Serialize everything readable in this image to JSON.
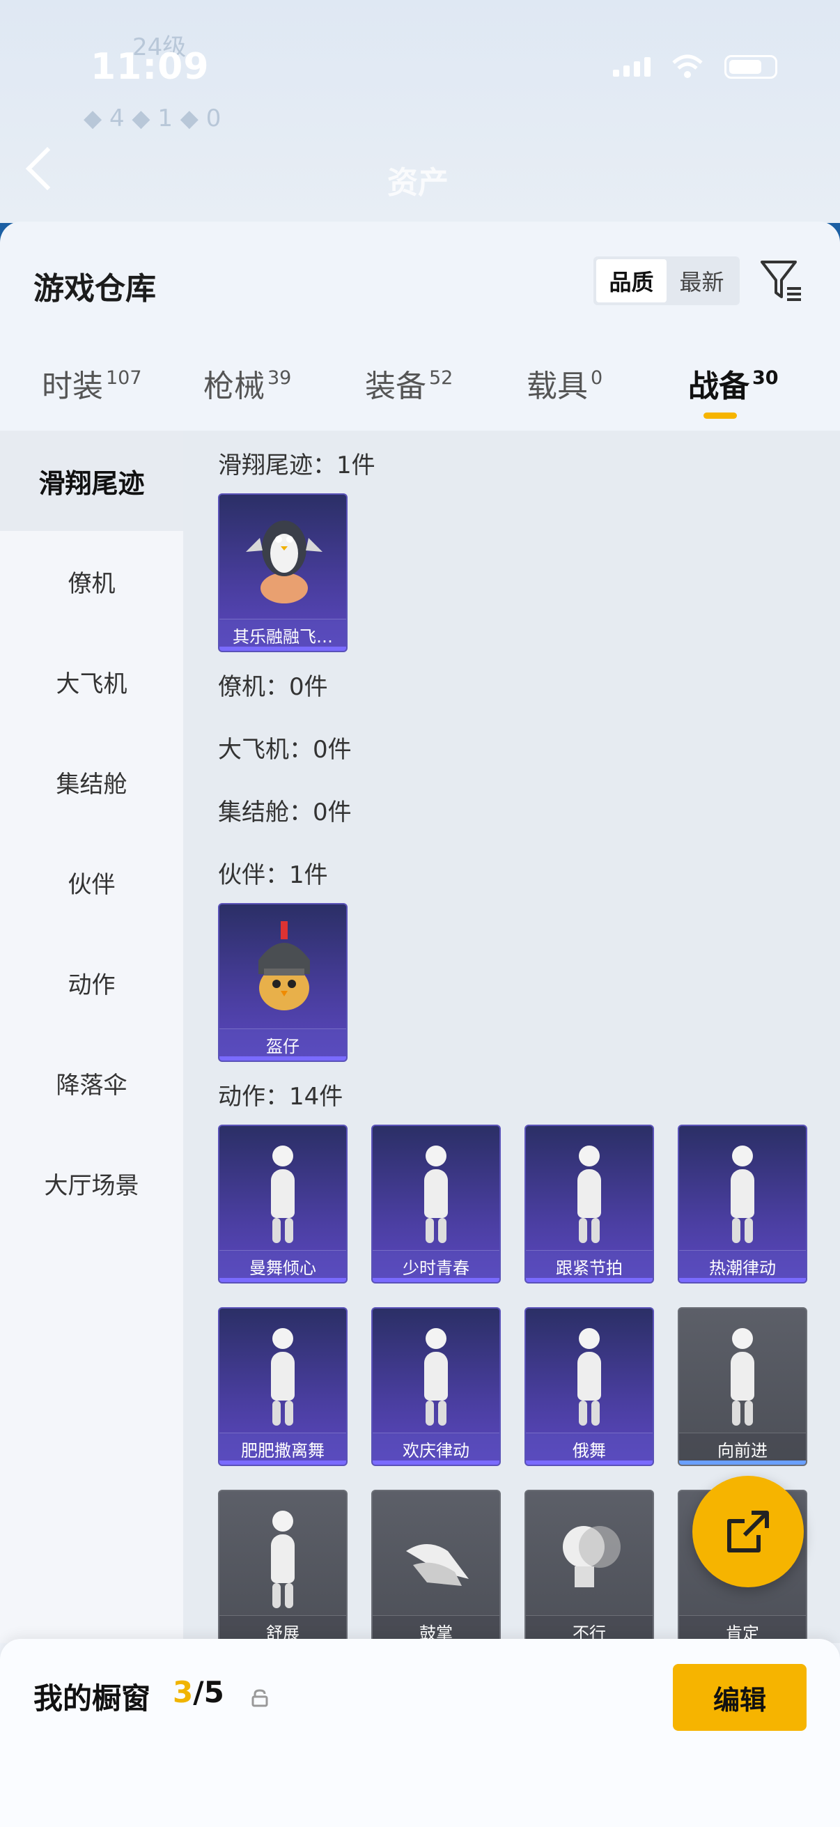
{
  "status": {
    "time": "11:09"
  },
  "header": {
    "title": "资产"
  },
  "sheet": {
    "title": "游戏仓库",
    "sort": {
      "options": [
        "品质",
        "最新"
      ],
      "selected": "品质"
    }
  },
  "tabs": [
    {
      "label": "时装",
      "count": "107"
    },
    {
      "label": "枪械",
      "count": "39"
    },
    {
      "label": "装备",
      "count": "52"
    },
    {
      "label": "载具",
      "count": "0"
    },
    {
      "label": "战备",
      "count": "30",
      "active": true
    }
  ],
  "sidebar": {
    "items": [
      "滑翔尾迹",
      "僚机",
      "大飞机",
      "集结舱",
      "伙伴",
      "动作",
      "降落伞",
      "大厅场景"
    ]
  },
  "sections": {
    "glide": {
      "title": "滑翔尾迹：1件",
      "items": [
        "其乐融融飞…"
      ]
    },
    "wingman": {
      "title": "僚机：0件"
    },
    "plane": {
      "title": "大飞机：0件"
    },
    "pod": {
      "title": "集结舱：0件"
    },
    "partner": {
      "title": "伙伴：1件",
      "items": [
        "盔仔"
      ]
    },
    "action": {
      "title": "动作：14件",
      "items": [
        "曼舞倾心",
        "少时青春",
        "跟紧节拍",
        "热潮律动",
        "肥肥撒离舞",
        "欢庆律动",
        "俄舞",
        "向前进",
        "舒展",
        "鼓掌",
        "不行",
        "肯定"
      ]
    }
  },
  "bottom": {
    "title": "我的橱窗",
    "current": "3",
    "total": "/5",
    "edit_label": "编辑"
  },
  "colors": {
    "accent": "#f6b400",
    "card_purple": "#4a3ea0",
    "card_gray": "#55585f"
  }
}
